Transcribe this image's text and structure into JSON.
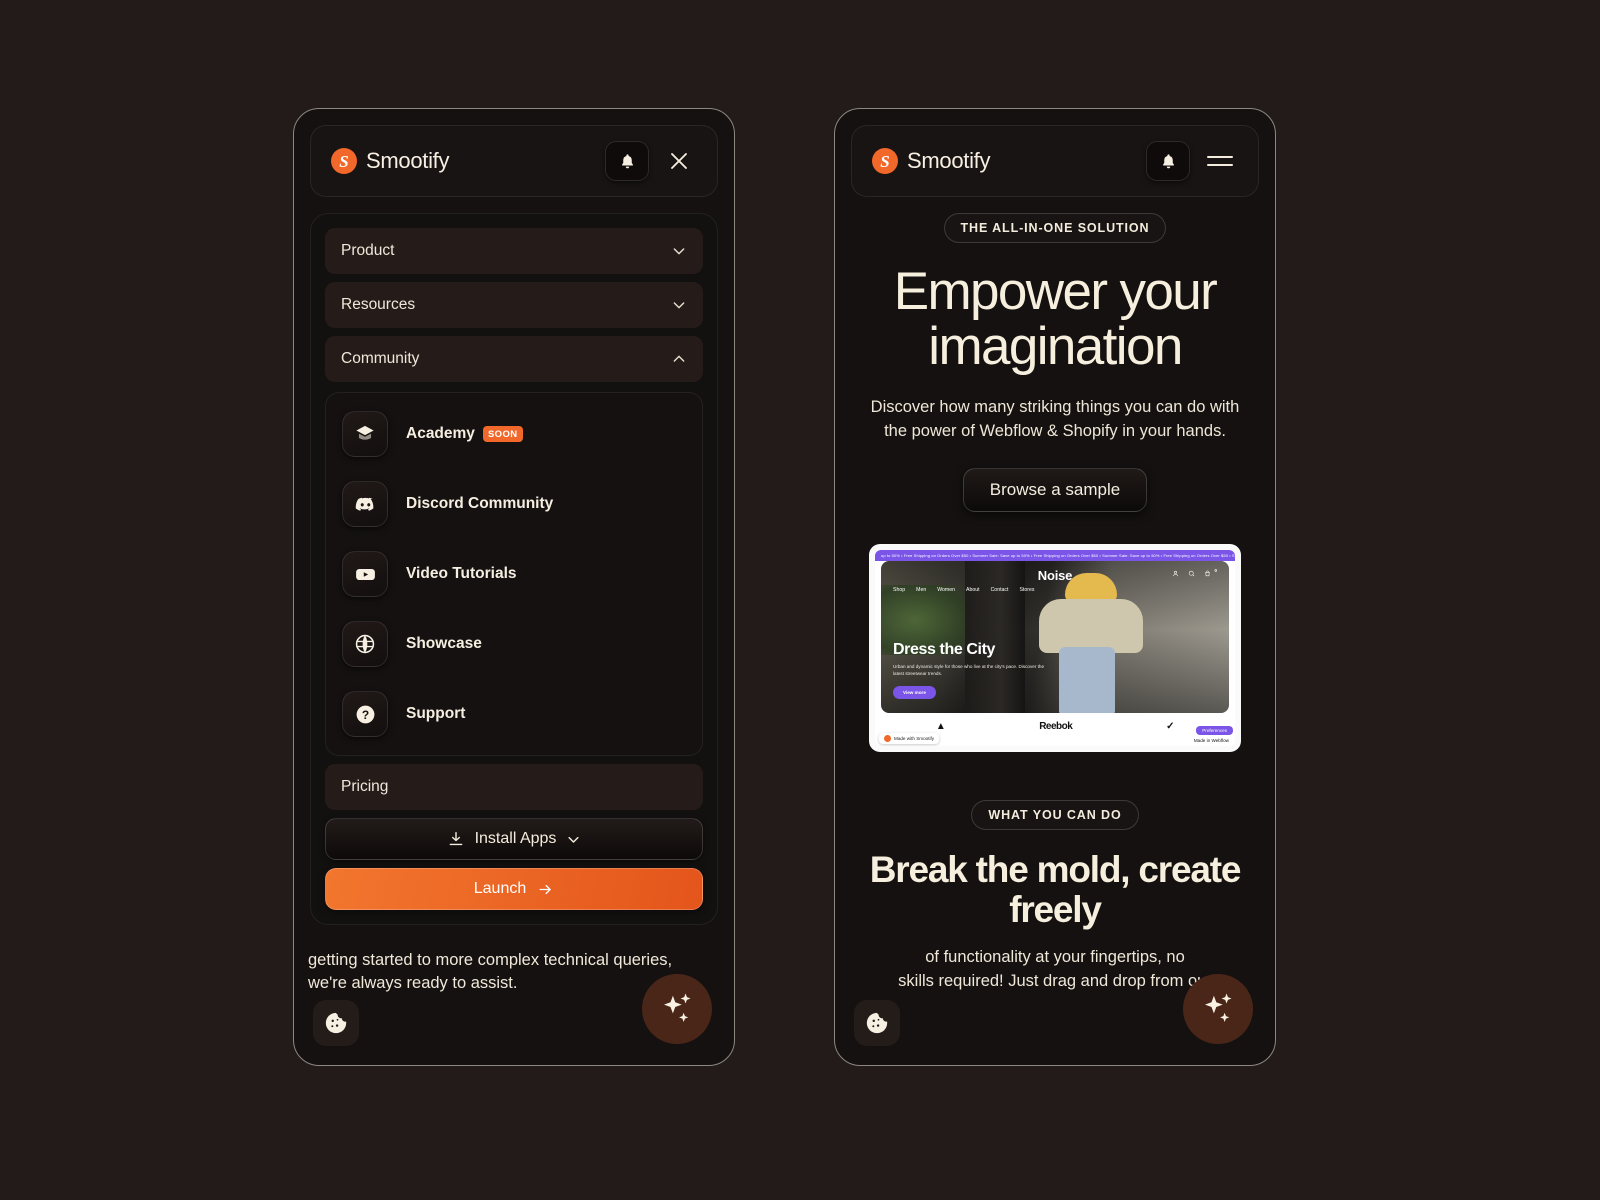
{
  "brand": {
    "name": "Smootify",
    "logo_letter": "S",
    "accent": "#f2682a"
  },
  "theme": {
    "page_bg": "#221b19",
    "panel_bg": "#141110",
    "text": "#f4ecdd"
  },
  "left_panel": {
    "header": {
      "notification_icon": "bell-icon",
      "close_icon": "close-icon"
    },
    "accordions": [
      {
        "label": "Product",
        "expanded": false,
        "chevron": "chevron-down-icon"
      },
      {
        "label": "Resources",
        "expanded": false,
        "chevron": "chevron-down-icon"
      },
      {
        "label": "Community",
        "expanded": true,
        "chevron": "chevron-up-icon"
      }
    ],
    "community_items": [
      {
        "label": "Academy",
        "badge": "SOON",
        "icon": "academy-cap-icon"
      },
      {
        "label": "Discord Community",
        "badge": "",
        "icon": "discord-icon"
      },
      {
        "label": "Video Tutorials",
        "badge": "",
        "icon": "youtube-icon"
      },
      {
        "label": "Showcase",
        "badge": "",
        "icon": "globe-icon"
      },
      {
        "label": "Support",
        "badge": "",
        "icon": "question-mark-icon"
      }
    ],
    "pricing_label": "Pricing",
    "install_label": "Install Apps",
    "install_icon": "download-icon",
    "install_chevron": "chevron-down-icon",
    "launch_label": "Launch",
    "launch_arrow": "arrow-right-icon",
    "background_text_line1": "getting started to more complex technical queries,",
    "background_text_line2": "we're always ready to assist."
  },
  "right_panel": {
    "header": {
      "notification_icon": "bell-icon",
      "menu_icon": "hamburger-menu-icon"
    },
    "hero": {
      "eyebrow": "THE ALL-IN-ONE SOLUTION",
      "title_line1": "Empower your",
      "title_line2": "imagination",
      "subtitle_line1": "Discover how many striking things you can do with",
      "subtitle_line2": "the power of Webflow & Shopify in your hands.",
      "cta_label": "Browse a sample"
    },
    "preview": {
      "marquee": "up to 50% • Free Shipping on Orders Over $50 • Summer Sale: Save up to 50% • Free Shipping on Orders Over $50 • Summer Sale: Save up to 50% • Free Shipping on Orders Over $50 • Summer Sale:",
      "site_name": "Noise",
      "nav_links": [
        "Shop",
        "Men",
        "Women",
        "About",
        "Contact",
        "Stores"
      ],
      "nav_icons": [
        "user-icon",
        "search-icon",
        "cart-icon"
      ],
      "cart_count": "0",
      "headline": "Dress the City",
      "paragraph": "Urban and dynamic style for those who live at the city's pace. Discover the latest streetwear trends.",
      "cta": "View more",
      "logos": [
        "adidas",
        "Reebok",
        "Nike"
      ],
      "badge_left": "Made with Smootify",
      "badge_pref": "Preferences",
      "badge_webflow": "Made in Webflow"
    },
    "section2": {
      "eyebrow": "WHAT YOU CAN DO",
      "title_line1": "Break the mold, create",
      "title_line2": "freely",
      "body_line1": "of functionality at your fingertips, no",
      "body_line2": "skills required! Just drag and drop from our"
    }
  },
  "widgets": {
    "cookie_icon": "cookie-icon",
    "sparkle_icon": "sparkle-icon"
  }
}
